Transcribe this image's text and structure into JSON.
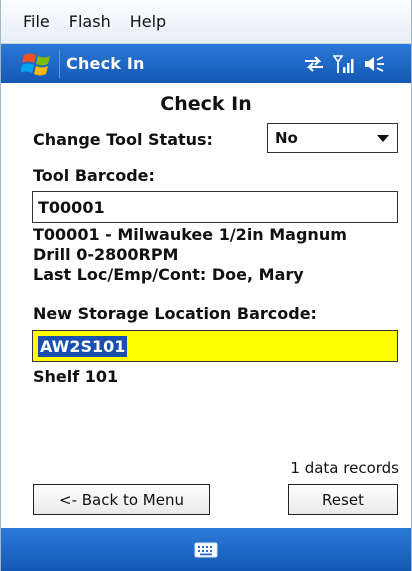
{
  "menubar": {
    "items": [
      "File",
      "Flash",
      "Help"
    ]
  },
  "titlebar": {
    "title": "Check In",
    "icons": [
      "windows-start-icon",
      "connectivity-icon",
      "signal-icon",
      "speaker-icon"
    ]
  },
  "page": {
    "heading": "Check In",
    "change_status": {
      "label": "Change Tool Status:",
      "value": "No"
    },
    "tool_barcode": {
      "label": "Tool Barcode:",
      "value": "T00001",
      "description_line1": "T00001 - Milwaukee 1/2in Magnum",
      "description_line2": "Drill 0-2800RPM",
      "last_loc": "Last Loc/Emp/Cont:  Doe, Mary"
    },
    "storage": {
      "label": "New Storage Location Barcode:",
      "value": "AW2S101",
      "description": "Shelf 101"
    },
    "records": "1 data records",
    "back_button": "<- Back to Menu",
    "reset_button": "Reset"
  },
  "bottombar": {
    "icon": "keyboard-icon"
  },
  "colors": {
    "title_bar": "#1f6bc8",
    "active_input": "#ffff00",
    "selection": "#1a4fb0"
  }
}
